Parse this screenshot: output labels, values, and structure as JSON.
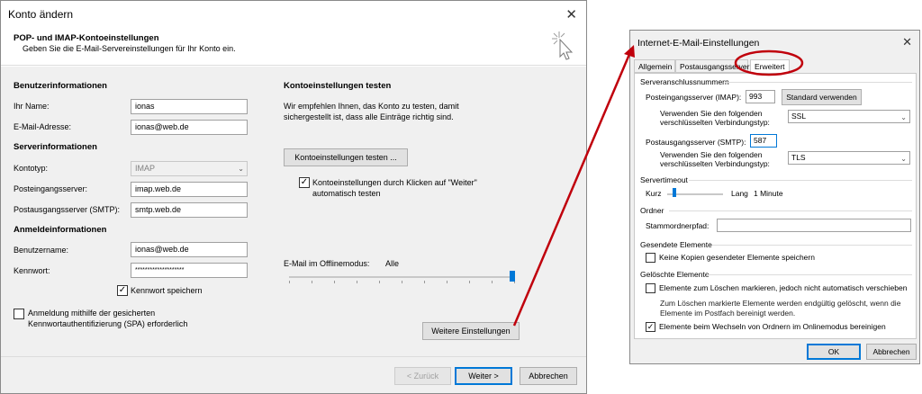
{
  "main_dialog": {
    "title": "Konto ändern",
    "header_title": "POP- und IMAP-Kontoeinstellungen",
    "header_subtitle": "Geben Sie die E-Mail-Servereinstellungen für Ihr Konto ein.",
    "user_section": "Benutzerinformationen",
    "name_label": "Ihr Name:",
    "name_value": "ionas",
    "email_label": "E-Mail-Adresse:",
    "email_value": "ionas@web.de",
    "server_section": "Serverinformationen",
    "account_type_label": "Kontotyp:",
    "account_type_value": "IMAP",
    "incoming_label": "Posteingangsserver:",
    "incoming_value": "imap.web.de",
    "outgoing_label": "Postausgangsserver (SMTP):",
    "outgoing_value": "smtp.web.de",
    "login_section": "Anmeldeinformationen",
    "username_label": "Benutzername:",
    "username_value": "ionas@web.de",
    "password_label": "Kennwort:",
    "password_value": "********************",
    "save_password_label": "Kennwort speichern",
    "spa_label_line1": "Anmeldung mithilfe der gesicherten",
    "spa_label_line2": "Kennwortauthentifizierung (SPA) erforderlich",
    "test_section": "Kontoeinstellungen testen",
    "test_desc_line1": "Wir empfehlen Ihnen, das Konto zu testen, damit",
    "test_desc_line2": "sichergestellt ist, dass alle Einträge richtig sind.",
    "test_button": "Kontoeinstellungen testen ...",
    "auto_test_line1": "Kontoeinstellungen durch Klicken auf \"Weiter\"",
    "auto_test_line2": "automatisch testen",
    "offline_label": "E-Mail im Offlinemodus:",
    "offline_value": "Alle",
    "offline_slider_level": 1.0,
    "more_settings_button": "Weitere Einstellungen",
    "back_button": "< Zurück",
    "next_button": "Weiter >",
    "cancel_button": "Abbrechen",
    "save_password_checked": true,
    "spa_checked": false,
    "auto_test_checked": true
  },
  "settings_dialog": {
    "title": "Internet-E-Mail-Einstellungen",
    "tabs": [
      "Allgemein",
      "Postausgangsserver",
      "Erweitert"
    ],
    "active_tab": "Erweitert",
    "ports_group": "Serveranschlussnummern",
    "incoming_port_label": "Posteingangsserver (IMAP):",
    "incoming_port_value": "993",
    "default_button": "Standard verwenden",
    "enc_label_line1": "Verwenden Sie den folgenden",
    "enc_label_line2": "verschlüsselten Verbindungstyp:",
    "incoming_enc_value": "SSL",
    "outgoing_port_label": "Postausgangsserver (SMTP):",
    "outgoing_port_value": "587",
    "outgoing_enc_value": "TLS",
    "timeout_group": "Servertimeout",
    "timeout_short": "Kurz",
    "timeout_long": "Lang",
    "timeout_value": "1 Minute",
    "timeout_slider_level": 0.1,
    "folder_group": "Ordner",
    "root_folder_label": "Stammordnerpfad:",
    "root_folder_value": "",
    "sent_group": "Gesendete Elemente",
    "no_copies_label": "Keine Kopien gesendeter Elemente speichern",
    "deleted_group": "Gelöschte Elemente",
    "mark_delete_label": "Elemente zum Löschen markieren, jedoch nicht automatisch verschieben",
    "mark_delete_info_line1": "Zum Löschen markierte Elemente werden endgültig gelöscht, wenn die",
    "mark_delete_info_line2": "Elemente im Postfach bereinigt werden.",
    "purge_label": "Elemente beim Wechseln von Ordnern im Onlinemodus bereinigen",
    "ok_button": "OK",
    "cancel_button": "Abbrechen",
    "no_copies_checked": false,
    "mark_delete_checked": false,
    "purge_checked": true
  },
  "colors": {
    "annotation": "#c0000c",
    "accent": "#0078d7"
  }
}
